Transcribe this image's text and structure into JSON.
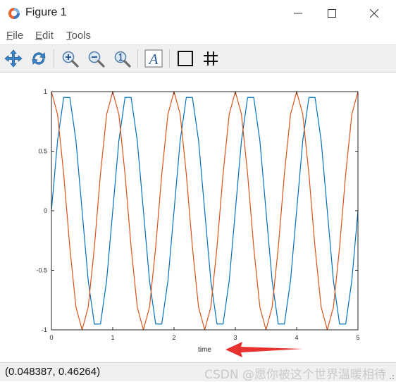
{
  "window": {
    "title": "Figure 1"
  },
  "menu": {
    "items": [
      {
        "label": "File",
        "mnemonic": "F",
        "rest": "ile"
      },
      {
        "label": "Edit",
        "mnemonic": "E",
        "rest": "dit"
      },
      {
        "label": "Tools",
        "mnemonic": "T",
        "rest": "ools"
      }
    ]
  },
  "toolbar": {
    "icons": [
      "pan-arrows-icon",
      "rotate-icon",
      "zoom-in-icon",
      "zoom-out-icon",
      "zoom-reset-icon",
      "text-insert-icon",
      "axes-box-icon",
      "grid-icon"
    ]
  },
  "status": {
    "coordinates": "(0.048387, 0.46264)",
    "watermark": "CSDN @愿你被这个世界温暖相待"
  },
  "annotation": {
    "arrow_color": "#e8322f"
  },
  "chart_data": {
    "type": "line",
    "xlabel": "time",
    "ylabel": "",
    "title": "",
    "xlim": [
      0,
      5
    ],
    "ylim": [
      -1,
      1
    ],
    "xticks": [
      "0",
      "1",
      "2",
      "3",
      "4",
      "5"
    ],
    "yticks": [
      "1",
      "0.5",
      "0",
      "-0.5",
      "-1"
    ],
    "grid": false,
    "x": [
      0,
      0.1,
      0.2,
      0.3,
      0.4,
      0.5,
      0.6,
      0.7,
      0.8,
      0.9,
      1.0,
      1.1,
      1.2,
      1.3,
      1.4,
      1.5,
      1.6,
      1.7,
      1.8,
      1.9,
      2.0,
      2.1,
      2.2,
      2.3,
      2.4,
      2.5,
      2.6,
      2.7,
      2.8,
      2.9,
      3.0,
      3.1,
      3.2,
      3.3,
      3.4,
      3.5,
      3.6,
      3.7,
      3.8,
      3.9,
      4.0,
      4.1,
      4.2,
      4.3,
      4.4,
      4.5,
      4.6,
      4.7,
      4.8,
      4.9,
      5.0
    ],
    "series": [
      {
        "color": "#0072bd",
        "values": [
          0,
          0.588,
          0.951,
          0.951,
          0.588,
          0,
          -0.588,
          -0.951,
          -0.951,
          -0.588,
          0,
          0.588,
          0.951,
          0.951,
          0.588,
          0,
          -0.588,
          -0.951,
          -0.951,
          -0.588,
          0,
          0.588,
          0.951,
          0.951,
          0.588,
          0,
          -0.588,
          -0.951,
          -0.951,
          -0.588,
          0,
          0.588,
          0.951,
          0.951,
          0.588,
          0,
          -0.588,
          -0.951,
          -0.951,
          -0.588,
          0,
          0.588,
          0.951,
          0.951,
          0.588,
          0,
          -0.588,
          -0.951,
          -0.951,
          -0.588,
          0
        ]
      },
      {
        "color": "#d95319",
        "values": [
          1,
          0.809,
          0.309,
          -0.309,
          -0.809,
          -1,
          -0.809,
          -0.309,
          0.309,
          0.809,
          1,
          0.809,
          0.309,
          -0.309,
          -0.809,
          -1,
          -0.809,
          -0.309,
          0.309,
          0.809,
          1,
          0.809,
          0.309,
          -0.309,
          -0.809,
          -1,
          -0.809,
          -0.309,
          0.309,
          0.809,
          1,
          0.809,
          0.309,
          -0.309,
          -0.809,
          -1,
          -0.809,
          -0.309,
          0.309,
          0.809,
          1,
          0.809,
          0.309,
          -0.309,
          -0.809,
          -1,
          -0.809,
          -0.309,
          0.309,
          0.809,
          1
        ]
      }
    ]
  }
}
